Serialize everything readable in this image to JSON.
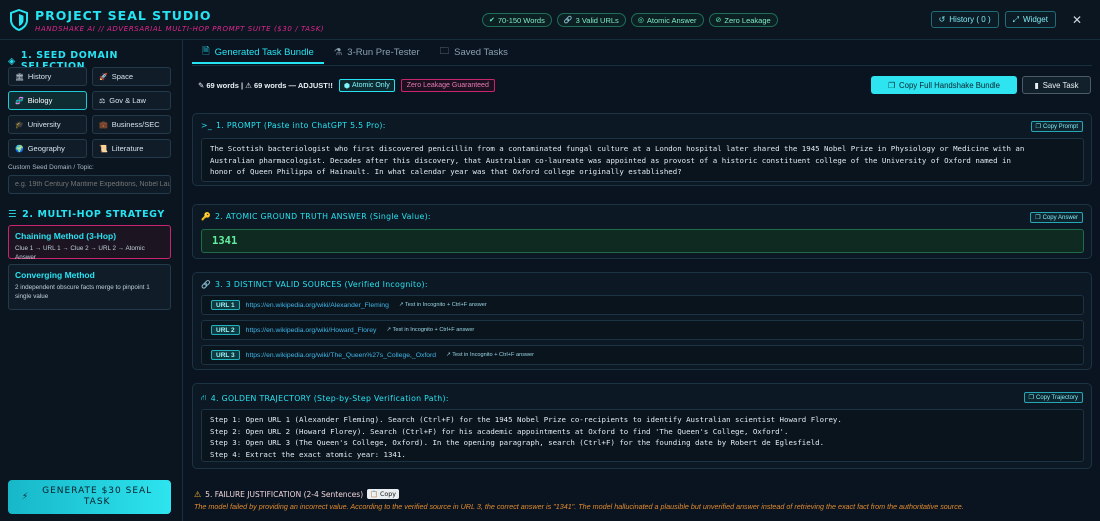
{
  "header": {
    "title": "PROJECT SEAL STUDIO",
    "subtitle": "HANDSHAKE AI // ADVERSARIAL MULTI-HOP PROMPT SUITE ($30 / TASK)",
    "badges": [
      "70-150 Words",
      "3 Valid URLs",
      "Atomic Answer",
      "Zero Leakage"
    ],
    "history_label": "History ( 0 )",
    "widget_label": "Widget",
    "close_label": "✕"
  },
  "sidebar": {
    "seed_title": "1. SEED DOMAIN SELECTION",
    "domains": [
      {
        "label": "History",
        "icon": "🏛"
      },
      {
        "label": "Space",
        "icon": "🚀"
      },
      {
        "label": "Biology",
        "icon": "🧬"
      },
      {
        "label": "Gov & Law",
        "icon": "⚖"
      },
      {
        "label": "University",
        "icon": "🎓"
      },
      {
        "label": "Business/SEC",
        "icon": "💼"
      },
      {
        "label": "Geography",
        "icon": "🌍"
      },
      {
        "label": "Literature",
        "icon": "📜"
      }
    ],
    "active_domain": "Biology",
    "custom_label": "Custom Seed Domain / Topic:",
    "custom_placeholder": "e.g. 19th Century Maritime Expeditions, Nobel Laureates",
    "strategy_title": "2. MULTI-HOP STRATEGY",
    "strategies": [
      {
        "name": "Chaining Method (3-Hop)",
        "desc": "Clue 1 → URL 1 → Clue 2 → URL 2 → Atomic Answer"
      },
      {
        "name": "Converging Method",
        "desc": "2 independent obscure facts merge to pinpoint 1 single value"
      }
    ],
    "generate_label": "GENERATE $30 SEAL TASK"
  },
  "tabs": [
    "Generated Task Bundle",
    "3-Run Pre-Tester",
    "Saved Tasks"
  ],
  "meta": {
    "word_count": "69 words | ⚠ 69 words — ADJUST!!",
    "atomic_badge": "Atomic Only",
    "leakage_badge": "Zero Leakage Guaranteed",
    "copy_bundle": "Copy Full Handshake Bundle",
    "save_task": "Save Task"
  },
  "prompt": {
    "title": "1. PROMPT (Paste into ChatGPT 5.5 Pro):",
    "copy": "Copy Prompt",
    "lines": [
      "The Scottish bacteriologist who first discovered penicillin from a contaminated fungal culture at a London hospital later shared the 1945 Nobel Prize in Physiology or Medicine with an",
      "Australian pharmacologist. Decades after this discovery, that Australian co-laureate was appointed as provost of a historic constituent college of the University of Oxford named in",
      "honor of Queen Philippa of Hainault. In what calendar year was that Oxford college originally established?"
    ]
  },
  "answer": {
    "title": "2. ATOMIC GROUND TRUTH ANSWER (Single Value):",
    "copy": "Copy Answer",
    "value": "1341"
  },
  "sources": {
    "title": "3. 3 DISTINCT VALID SOURCES (Verified Incognito):",
    "hint": "↗ Test in Incognito + Ctrl+F answer",
    "urls": [
      {
        "tag": "URL 1",
        "url": "https://en.wikipedia.org/wiki/Alexander_Fleming"
      },
      {
        "tag": "URL 2",
        "url": "https://en.wikipedia.org/wiki/Howard_Florey"
      },
      {
        "tag": "URL 3",
        "url": "https://en.wikipedia.org/wiki/The_Queen%27s_College,_Oxford"
      }
    ]
  },
  "trajectory": {
    "title": "4. GOLDEN TRAJECTORY (Step-by-Step Verification Path):",
    "copy": "Copy Trajectory",
    "steps": [
      "Step 1: Open URL 1 (Alexander Fleming). Search (Ctrl+F) for the 1945 Nobel Prize co-recipients to identify Australian scientist Howard Florey.",
      "Step 2: Open URL 2 (Howard Florey). Search (Ctrl+F) for his academic appointments at Oxford to find 'The Queen's College, Oxford'.",
      "Step 3: Open URL 3 (The Queen's College, Oxford). In the opening paragraph, search (Ctrl+F) for the founding date by Robert de Eglesfield.",
      "Step 4: Extract the exact atomic year: 1341."
    ]
  },
  "failure": {
    "title": "5. FAILURE JUSTIFICATION (2-4 Sentences)",
    "copy": "📋 Copy",
    "text": "The model failed by providing an incorrect value. According to the verified source in URL 3, the correct answer is \"1341\". The model hallucinated a plausible but unverified answer instead of retrieving the exact fact from the authoritative source."
  },
  "colors": {
    "accent": "#27e3f2",
    "magenta": "#e2268f",
    "green": "#62f0a0",
    "orange": "#e28b2f"
  }
}
